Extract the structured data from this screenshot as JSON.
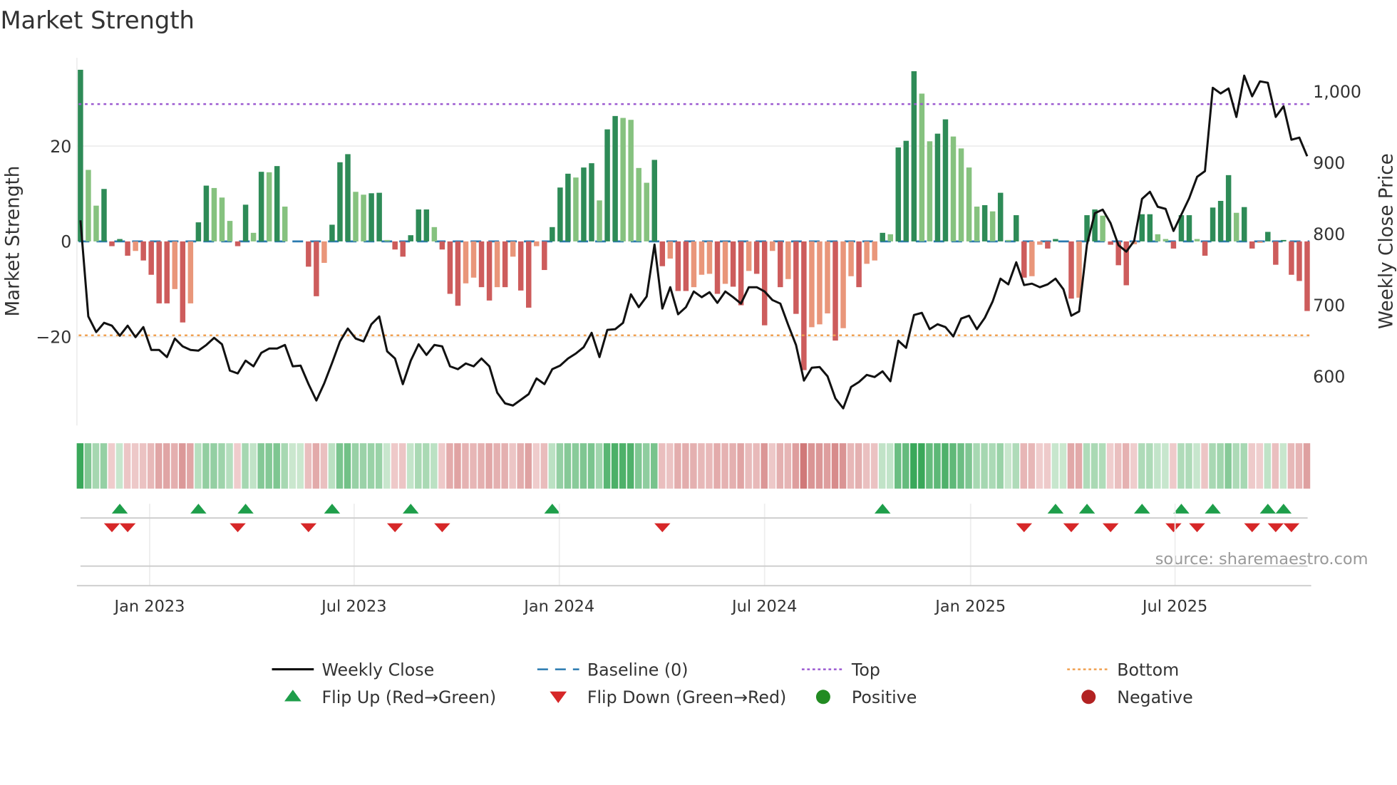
{
  "chart_data": {
    "type": "bar+line",
    "title": "Market Strength",
    "ylabel_left": "Market Strength",
    "ylabel_right": "Weekly Close Price",
    "source": "source: sharemaestro.com",
    "ylim_left": [
      -38.6,
      38.5
    ],
    "ylim_right": [
      531,
      1047
    ],
    "left_ticks": [
      {
        "value": 20,
        "label": "20"
      },
      {
        "value": 0,
        "label": "0"
      },
      {
        "value": -20,
        "label": "−20"
      }
    ],
    "right_ticks": [
      {
        "value": 1000,
        "label": "1,000"
      },
      {
        "value": 900,
        "label": "900"
      },
      {
        "value": 800,
        "label": "800"
      },
      {
        "value": 700,
        "label": "700"
      },
      {
        "value": 600,
        "label": "600"
      }
    ],
    "x_ticks": [
      {
        "week": 8.8,
        "label": "Jan 2023"
      },
      {
        "week": 34.8,
        "label": "Jul 2023"
      },
      {
        "week": 60.9,
        "label": "Jan 2024"
      },
      {
        "week": 87.0,
        "label": "Jul 2024"
      },
      {
        "week": 113.2,
        "label": "Jan 2025"
      },
      {
        "week": 139.2,
        "label": "Jul 2025"
      }
    ],
    "top_level": 28.8,
    "bottom_level": -19.7,
    "baseline": 0,
    "strength": [
      36,
      15,
      7.5,
      11,
      -1,
      0.5,
      -3,
      -2,
      -4,
      -7,
      -13,
      -13,
      -10,
      -17,
      -13,
      4,
      11.7,
      11.2,
      9.2,
      4.3,
      -1,
      7.7,
      1.8,
      14.6,
      14.5,
      15.8,
      7.3,
      0,
      0,
      -5.3,
      -11.5,
      -4.5,
      3.5,
      16.6,
      18.3,
      10.4,
      9.8,
      10.1,
      10.2,
      0.3,
      -1.7,
      -3.2,
      1.3,
      6.7,
      6.7,
      3,
      -1.7,
      -11,
      -13.5,
      -8.8,
      -7.6,
      -9.6,
      -12.4,
      -9.6,
      -9.6,
      -3.2,
      -10.3,
      -13.9,
      -1,
      -6,
      3,
      11.3,
      14.2,
      13.4,
      15.5,
      16.4,
      8.6,
      23.5,
      26.3,
      25.9,
      25.5,
      15.4,
      12.3,
      17.1,
      -5.2,
      -3.6,
      -10.4,
      -10.4,
      -9.6,
      -7,
      -6.8,
      -11,
      -8.9,
      -9.5,
      -13.4,
      -6.2,
      -6.8,
      -17.6,
      -2,
      -9.6,
      -7.9,
      -15.2,
      -27,
      -18,
      -17.4,
      -15.1,
      -20.8,
      -18.2,
      -7.3,
      -9.6,
      -4.7,
      -4,
      1.8,
      1.5,
      19.7,
      21.1,
      35.7,
      31,
      21,
      22.6,
      25.6,
      22,
      19.5,
      15.5,
      7.3,
      7.6,
      6.3,
      10.2,
      0.3,
      5.5,
      -7.6,
      -7.3,
      -0.7,
      -1.5,
      0.5,
      0,
      -12,
      -11.8,
      5.5,
      6.7,
      5.4,
      -0.7,
      -5,
      -9.2,
      -0.6,
      5.7,
      5.7,
      1.5,
      0.5,
      -1.5,
      5.5,
      5.5,
      0.5,
      -3,
      7.1,
      8.5,
      13.9,
      6,
      7.2,
      -1.5,
      -0.3,
      2,
      -4.9,
      0.3,
      -7,
      -8.3,
      -14.6
    ],
    "weekly_close": [
      819,
      684,
      662,
      675,
      671,
      657,
      671,
      655,
      669,
      637,
      637,
      627,
      653,
      642,
      637,
      636,
      644,
      654,
      645,
      608,
      604,
      622,
      614,
      633,
      639,
      639,
      644,
      614,
      615,
      589,
      566,
      590,
      619,
      649,
      667,
      653,
      649,
      673,
      684,
      635,
      625,
      589,
      622,
      645,
      630,
      644,
      642,
      614,
      610,
      618,
      614,
      625,
      614,
      577,
      562,
      559,
      567,
      575,
      597,
      589,
      610,
      615,
      625,
      632,
      641,
      661,
      627,
      665,
      666,
      675,
      715,
      697,
      712,
      785,
      695,
      725,
      687,
      697,
      719,
      711,
      718,
      703,
      719,
      711,
      702,
      725,
      725,
      719,
      707,
      702,
      672,
      644,
      594,
      612,
      613,
      600,
      569,
      555,
      585,
      592,
      602,
      599,
      607,
      593,
      650,
      640,
      686,
      689,
      666,
      673,
      669,
      656,
      681,
      685,
      666,
      682,
      705,
      737,
      729,
      760,
      728,
      730,
      725,
      729,
      737,
      722,
      685,
      691,
      785,
      829,
      834,
      815,
      784,
      775,
      790,
      849,
      859,
      838,
      835,
      804,
      827,
      850,
      880,
      888,
      1005,
      997,
      1004,
      964,
      1022,
      993,
      1014,
      1012,
      964,
      979,
      932,
      935,
      909
    ],
    "flip_up_weeks": [
      5,
      15,
      21,
      32,
      42,
      60,
      102,
      124,
      128,
      135,
      140,
      144,
      151,
      153
    ],
    "flip_down_weeks": [
      4,
      6,
      20,
      29,
      40,
      46,
      74,
      120,
      126,
      131,
      139,
      142,
      149,
      152,
      154
    ],
    "colors": {
      "strong_positive": "#2e8b57",
      "weak_positive": "#86c27f",
      "strong_negative": "#cd5c5c",
      "weak_negative": "#e9967a",
      "line": "#111111",
      "baseline": "#2a7ab0",
      "top": "#9b59d0",
      "bottom": "#f0a050",
      "flip_up": "#1e9e4a",
      "flip_down": "#d62728",
      "positive": "#228b22",
      "negative": "#b22222"
    },
    "legend": [
      {
        "label": "Weekly Close",
        "kind": "line"
      },
      {
        "label": "Baseline (0)",
        "kind": "baseline"
      },
      {
        "label": "Top",
        "kind": "top"
      },
      {
        "label": "Bottom",
        "kind": "bottom"
      },
      {
        "label": "Flip Up (Red→Green)",
        "kind": "up"
      },
      {
        "label": "Flip Down (Green→Red)",
        "kind": "down"
      },
      {
        "label": "Positive",
        "kind": "pos"
      },
      {
        "label": "Negative",
        "kind": "neg"
      }
    ]
  }
}
